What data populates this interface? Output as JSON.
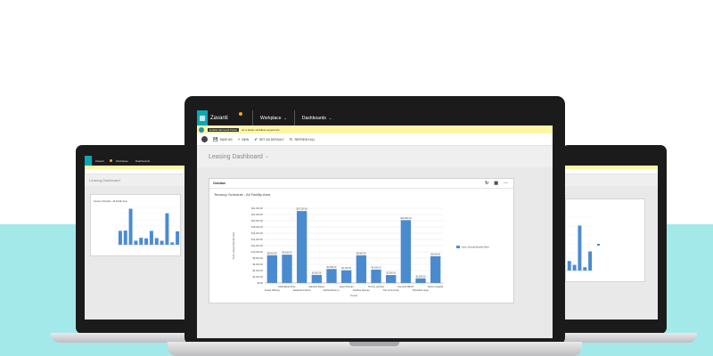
{
  "app": {
    "brand": "Zavanti",
    "nav": [
      {
        "label": "Workplace"
      },
      {
        "label": "Dashboards"
      }
    ]
  },
  "notification": {
    "button": "Enable Microsoft Flows",
    "text": "for a better workflow experience"
  },
  "commands": [
    {
      "glyph": "💾",
      "label": "SAVE AS"
    },
    {
      "glyph": "+",
      "label": "NEW"
    },
    {
      "glyph": "✔",
      "label": "SET AS DEFAULT"
    },
    {
      "glyph": "↻",
      "label": "REFRESH ALL"
    }
  ],
  "page": {
    "title": "Leasing Dashboard"
  },
  "widget": {
    "header": "Overdue"
  },
  "colors": {
    "bar": "#4a8bd0",
    "accent": "#0aa6b5",
    "brand_dot": "#f4a521",
    "topbar": "#1b1b1b",
    "notify": "#fff6a4",
    "teal_band": "#a3e9ea"
  },
  "icons": [
    "waffle-menu-icon",
    "nav-back-icon",
    "refresh-icon",
    "expand-icon",
    "more-icon",
    "page-caret-icon"
  ],
  "chart_data": {
    "type": "bar",
    "title": "Tenancy Schedule - All Facility Area",
    "xlabel": "Tenant",
    "ylabel": "Sum: Annual Monthly Rent",
    "ylim": [
      0,
      24000
    ],
    "yticks": [
      "$0.00",
      "$2,000.00",
      "$4,000.00",
      "$6,000.00",
      "$8,000.00",
      "$10,000.00",
      "$12,000.00",
      "$14,000.00",
      "$16,000.00",
      "$18,000.00",
      "$20,000.00",
      "$22,000.00",
      "$24,000.00"
    ],
    "categories": [
      "Fraser Whiting",
      "Mulholland Drive",
      "Sarasota Frisconi",
      "Stanford Rosen",
      "Vanhoutheren L.",
      "Aston Pluvian",
      "Pacifica Niemas",
      "Thorns Junction",
      "The Community",
      "Osmond DEVIT",
      "Brookline Hope",
      "Moore Analytic"
    ],
    "tick_labels_lower": [
      "Fraser Whiting",
      "Sarasota Frisconi",
      "Vanhoutheren L.",
      "Pacifica Niemas",
      "The Community",
      "Brookline Hope"
    ],
    "tick_labels_upper": [
      "Mulholland Drive",
      "Stanford Rosen",
      "Aston Pluvian",
      "Thorns Junction",
      "Osmond DEVIT",
      "Moore Analytic"
    ],
    "values": [
      8920,
      9100,
      23120,
      2600,
      4500,
      4100,
      8900,
      4300,
      2560,
      20200,
      1500,
      8600
    ],
    "data_labels": [
      "$8,920.00",
      "$9,100.00",
      "$23,120.00",
      "$2,600.00",
      "$4,500.00",
      "$4,100.00",
      "$8,900.00",
      "$4,300.00",
      "$2,560.00",
      "$20,200.00",
      "$1,500.00",
      "$8,600.00"
    ],
    "legend": {
      "label": "Sum: Annual Monthly Rent",
      "position": "right"
    },
    "grid": true
  }
}
